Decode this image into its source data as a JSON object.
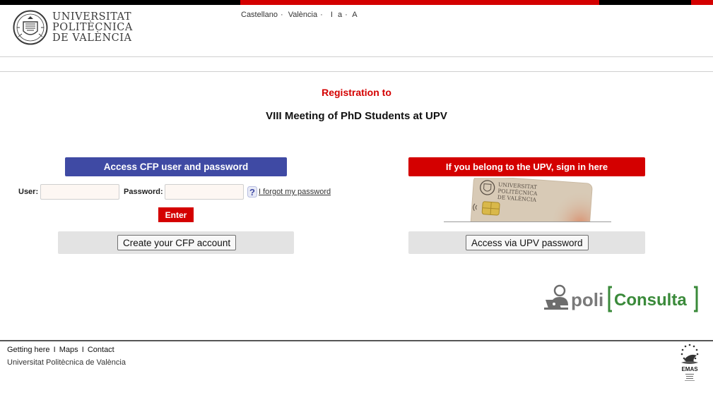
{
  "header": {
    "university_name_line1": "UNIVERSITAT",
    "university_name_line2": "POLITÈCNICA",
    "university_name_line3": "DE VALÈNCIA",
    "languages": [
      "Castellano",
      "·",
      "València",
      "·"
    ],
    "font_size_controls": [
      "I",
      "a",
      "·",
      "A"
    ]
  },
  "titles": {
    "registration": "Registration to",
    "event": "VIII Meeting of PhD Students at UPV"
  },
  "cfp_login": {
    "header": "Access CFP user and password",
    "user_label": "User:",
    "user_value": "",
    "password_label": "Password:",
    "password_value": "",
    "forgot_link": "I forgot my password",
    "enter_button": "Enter",
    "create_account_button": "Create your CFP account"
  },
  "upv_login": {
    "header": "If you belong to the UPV, sign in here",
    "card_text_line1": "UNIVERSITAT",
    "card_text_line2": "POLITÈCNICA",
    "card_text_line3": "DE VALÈNCIA",
    "access_button": "Access via UPV password"
  },
  "poliConsulta": {
    "prefix": "poli",
    "name": "Consulta"
  },
  "footer": {
    "links": [
      "Getting here",
      "Maps",
      "Contact"
    ],
    "separator": "I",
    "university": "Universitat Politècnica de València",
    "emas_label": "EMAS"
  },
  "colors": {
    "brand_red": "#d40000",
    "cfp_blue": "#3f4aa4",
    "panel_grey": "#e3e3e3",
    "poliConsulta_green": "#3a8a3a"
  }
}
